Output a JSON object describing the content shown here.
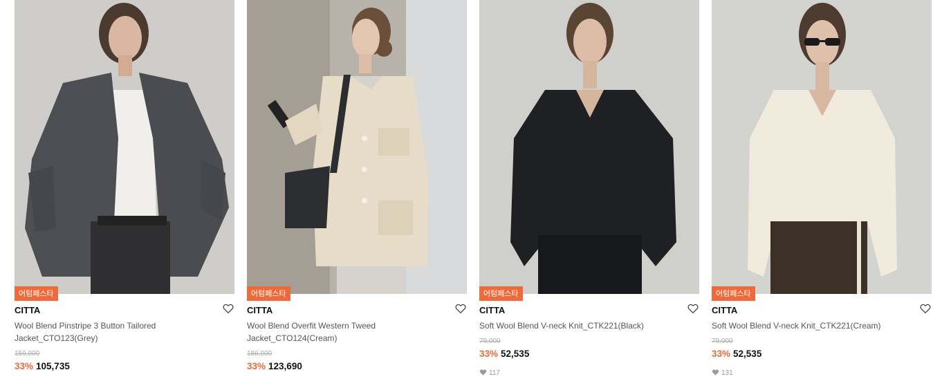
{
  "products": [
    {
      "badge": "어텀페스타",
      "brand": "CITTA",
      "name": "Wool Blend Pinstripe 3 Button Tailored Jacket_CTO123(Grey)",
      "original_price": "159,000",
      "discount": "33%",
      "price": "105,735",
      "likes": ""
    },
    {
      "badge": "어텀페스타",
      "brand": "CITTA",
      "name": "Wool Blend Overfit Western Tweed Jacket_CTO124(Cream)",
      "original_price": "186,000",
      "discount": "33%",
      "price": "123,690",
      "likes": ""
    },
    {
      "badge": "어텀페스타",
      "brand": "CITTA",
      "name": "Soft Wool Blend V-neck Knit_CTK221(Black)",
      "original_price": "79,000",
      "discount": "33%",
      "price": "52,535",
      "likes": "117"
    },
    {
      "badge": "어텀페스타",
      "brand": "CITTA",
      "name": "Soft Wool Blend V-neck Knit_CTK221(Cream)",
      "original_price": "79,000",
      "discount": "33%",
      "price": "52,535",
      "likes": "131"
    }
  ],
  "colors": {
    "accent": "#ef6a3b",
    "price": "#111111",
    "strike": "#aaaaaa"
  },
  "icons": {
    "like": "heart-outline-icon",
    "likes_count": "heart-filled-icon"
  }
}
